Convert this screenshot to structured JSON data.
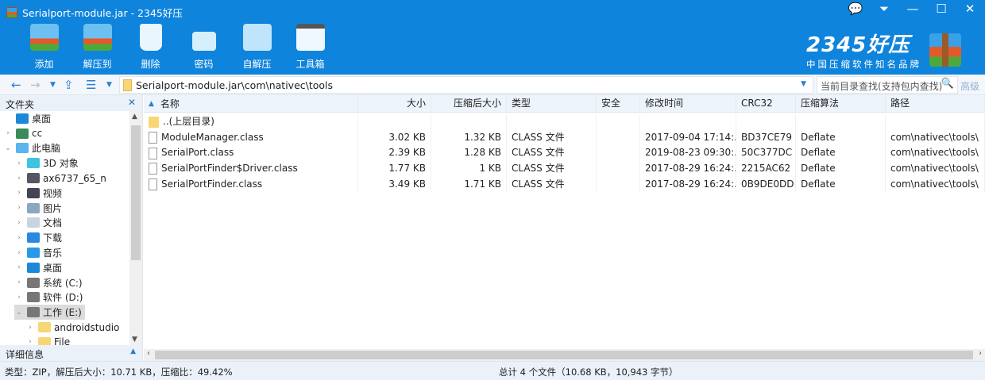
{
  "window": {
    "title": "Serialport-module.jar - 2345好压",
    "controls": [
      "💬",
      "⏷",
      "—",
      "☐",
      "✕"
    ]
  },
  "toolbar": [
    {
      "label": "添加",
      "icon": "add-icon"
    },
    {
      "label": "解压到",
      "icon": "extract-icon"
    },
    {
      "label": "删除",
      "icon": "delete-icon"
    },
    {
      "label": "密码",
      "icon": "lock-icon"
    },
    {
      "label": "自解压",
      "icon": "sfx-icon"
    },
    {
      "label": "工具箱",
      "icon": "toolbox-icon"
    }
  ],
  "brand": {
    "name": "2345好压",
    "slogan": "中国压缩软件知名品牌"
  },
  "nav": {
    "path": "Serialport-module.jar\\com\\nativec\\tools",
    "search_placeholder": "当前目录查找(支持包内查找)",
    "advanced": "高级"
  },
  "left": {
    "header": "文件夹",
    "footer": "详细信息",
    "items": [
      {
        "label": "桌面",
        "level": 0,
        "arrow": "",
        "icon": "desktop-icon",
        "color": "#1e88d8"
      },
      {
        "label": "cc",
        "level": 0,
        "arrow": "›",
        "icon": "user-icon",
        "color": "#3a8a5a"
      },
      {
        "label": "此电脑",
        "level": 0,
        "arrow": "⌄",
        "icon": "computer-icon",
        "color": "#5ab4ee"
      },
      {
        "label": "3D 对象",
        "level": 1,
        "arrow": "›",
        "icon": "3d-objects-icon",
        "color": "#3cc4e0"
      },
      {
        "label": "ax6737_65_n",
        "level": 1,
        "arrow": "›",
        "icon": "phone-icon",
        "color": "#556"
      },
      {
        "label": "视频",
        "level": 1,
        "arrow": "›",
        "icon": "video-icon",
        "color": "#445"
      },
      {
        "label": "图片",
        "level": 1,
        "arrow": "›",
        "icon": "picture-icon",
        "color": "#8aa8c0"
      },
      {
        "label": "文档",
        "level": 1,
        "arrow": "›",
        "icon": "document-icon",
        "color": "#c8d4e0"
      },
      {
        "label": "下载",
        "level": 1,
        "arrow": "›",
        "icon": "download-icon",
        "color": "#2a88e0"
      },
      {
        "label": "音乐",
        "level": 1,
        "arrow": "›",
        "icon": "music-icon",
        "color": "#2a9ae8"
      },
      {
        "label": "桌面",
        "level": 1,
        "arrow": "›",
        "icon": "desktop-icon",
        "color": "#1e88d8"
      },
      {
        "label": "系统 (C:)",
        "level": 1,
        "arrow": "›",
        "icon": "drive-icon",
        "color": "#777"
      },
      {
        "label": "软件 (D:)",
        "level": 1,
        "arrow": "›",
        "icon": "drive-icon",
        "color": "#777"
      },
      {
        "label": "工作 (E:)",
        "level": 1,
        "arrow": "⌄",
        "icon": "drive-icon",
        "color": "#777",
        "selected": true
      },
      {
        "label": "androidstudio",
        "level": 2,
        "arrow": "›",
        "icon": "folder-icon",
        "color": "#f8d675"
      },
      {
        "label": "File",
        "level": 2,
        "arrow": "›",
        "icon": "folder-icon",
        "color": "#f8d675"
      }
    ]
  },
  "columns": [
    "名称",
    "大小",
    "压缩后大小",
    "类型",
    "安全",
    "修改时间",
    "CRC32",
    "压缩算法",
    "路径"
  ],
  "parent_row": "..(上层目录)",
  "files": [
    {
      "name": "ModuleManager.class",
      "size": "3.02 KB",
      "packed": "1.32 KB",
      "type": "CLASS 文件",
      "secure": "",
      "mtime": "2017-09-04 17:14:...",
      "crc": "BD37CE79",
      "method": "Deflate",
      "path": "com\\nativec\\tools\\"
    },
    {
      "name": "SerialPort.class",
      "size": "2.39 KB",
      "packed": "1.28 KB",
      "type": "CLASS 文件",
      "secure": "",
      "mtime": "2019-08-23 09:30:...",
      "crc": "50C377DC",
      "method": "Deflate",
      "path": "com\\nativec\\tools\\"
    },
    {
      "name": "SerialPortFinder$Driver.class",
      "size": "1.77 KB",
      "packed": "1 KB",
      "type": "CLASS 文件",
      "secure": "",
      "mtime": "2017-08-29 16:24:...",
      "crc": "2215AC62",
      "method": "Deflate",
      "path": "com\\nativec\\tools\\"
    },
    {
      "name": "SerialPortFinder.class",
      "size": "3.49 KB",
      "packed": "1.71 KB",
      "type": "CLASS 文件",
      "secure": "",
      "mtime": "2017-08-29 16:24:...",
      "crc": "0B9DE0DD",
      "method": "Deflate",
      "path": "com\\nativec\\tools\\"
    }
  ],
  "status": {
    "left": "类型：ZIP，解压后大小：10.71 KB，压缩比：49.42%",
    "center": "总计 4 个文件（10.68 KB，10,943 字节）"
  }
}
